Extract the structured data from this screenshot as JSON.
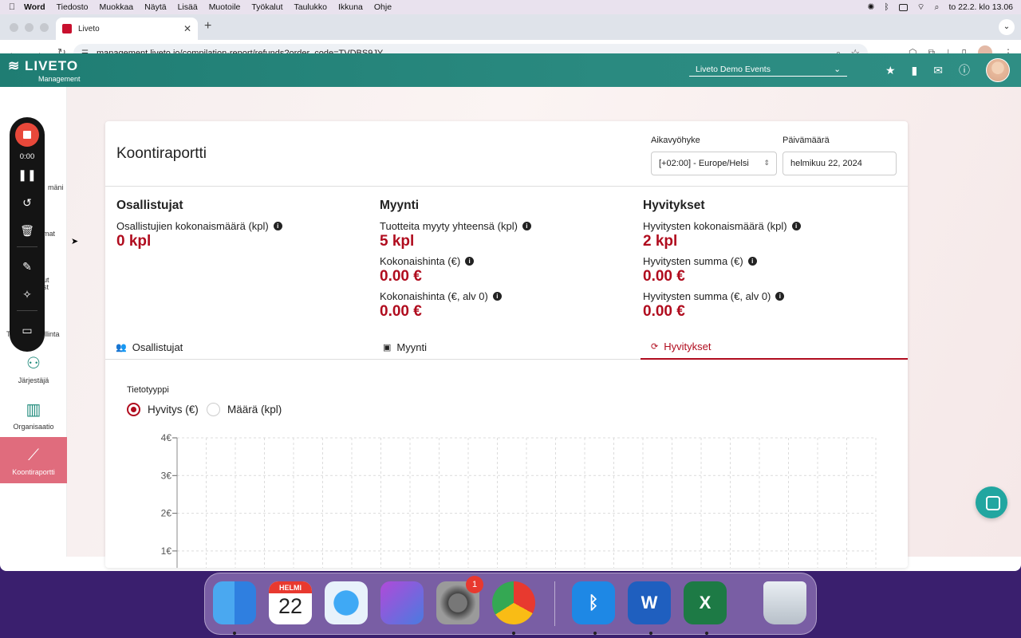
{
  "menubar": {
    "items": [
      "Word",
      "Tiedosto",
      "Muokkaa",
      "Näytä",
      "Lisää",
      "Muotoile",
      "Työkalut",
      "Taulukko",
      "Ikkuna",
      "Ohje"
    ],
    "clock": "to 22.2. klo 13.06"
  },
  "browser": {
    "tab_title": "Liveto",
    "url": "management.liveto.io/compilation-report/refunds?order_code=TVDBS9JY"
  },
  "header": {
    "logo": "LIVETO",
    "logo_sub": "Management",
    "event": "Liveto Demo Events"
  },
  "sidebar": {
    "items": [
      {
        "label": "Järjestäjä"
      },
      {
        "label": "Organisaatio"
      },
      {
        "label": "Koontiraportti"
      }
    ],
    "partial_labels": [
      "mäni",
      "mat",
      "ut",
      "st",
      "T",
      "llinta"
    ]
  },
  "recorder": {
    "time": "0:00"
  },
  "report": {
    "title": "Koontiraportti",
    "timezone_label": "Aikavyöhyke",
    "timezone_value": "[+02:00] - Europe/Helsi",
    "date_label": "Päivämäärä",
    "date_value": "helmikuu 22, 2024"
  },
  "columns": {
    "participants": {
      "title": "Osallistujat",
      "m1_label": "Osallistujien kokonaismäärä (kpl)",
      "m1_value": "0 kpl"
    },
    "sales": {
      "title": "Myynti",
      "m1_label": "Tuotteita myyty yhteensä (kpl)",
      "m1_value": "5 kpl",
      "m2_label": "Kokonaishinta (€)",
      "m2_value": "0.00 €",
      "m3_label": "Kokonaishinta (€, alv 0)",
      "m3_value": "0.00 €"
    },
    "refunds": {
      "title": "Hyvitykset",
      "m1_label": "Hyvitysten kokonaismäärä (kpl)",
      "m1_value": "2 kpl",
      "m2_label": "Hyvitysten summa (€)",
      "m2_value": "0.00 €",
      "m3_label": "Hyvitysten summa (€, alv 0)",
      "m3_value": "0.00 €"
    }
  },
  "tabs": {
    "participants": "Osallistujat",
    "sales": "Myynti",
    "refunds": "Hyvitykset"
  },
  "data_type": {
    "label": "Tietotyyppi",
    "option1": "Hyvitys (€)",
    "option2": "Määrä (kpl)",
    "selected": "Hyvitys (€)"
  },
  "chart_data": {
    "type": "bar",
    "title": "",
    "xlabel": "",
    "ylabel": "",
    "y_ticks": [
      "4€",
      "3€",
      "2€",
      "1€"
    ],
    "y_tick_values": [
      4,
      3,
      2,
      1
    ],
    "ylim": [
      0,
      4
    ],
    "grid": true,
    "series": []
  },
  "dock": {
    "calendar_month": "HELMI",
    "calendar_day": "22",
    "settings_badge": "1"
  },
  "colors": {
    "accent": "#b00c1e",
    "header": "#1f7d73",
    "sidebar_active": "#e06c7d"
  }
}
